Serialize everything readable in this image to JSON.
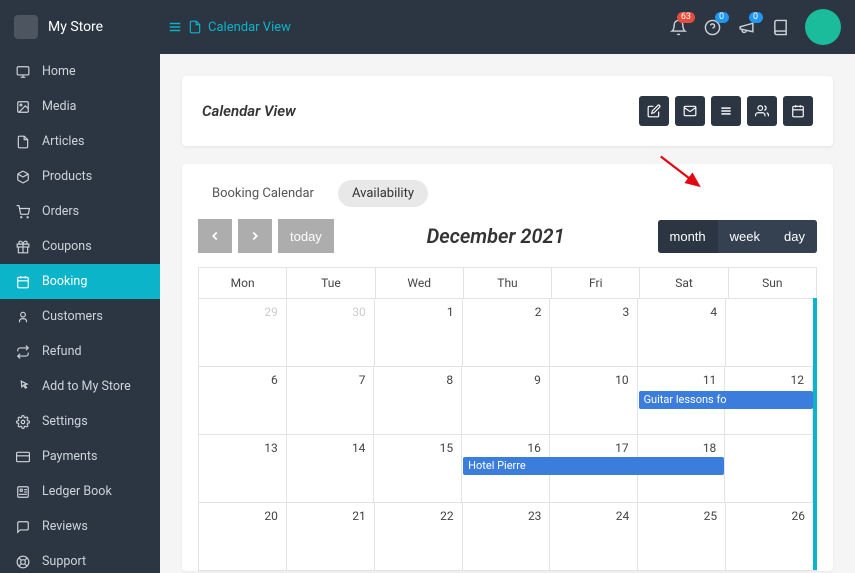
{
  "header": {
    "brand": "My Store",
    "breadcrumb": "Calendar View"
  },
  "top_badges": {
    "notifications": "63",
    "help": "0",
    "announce": "0"
  },
  "sidebar": {
    "items": [
      {
        "label": "Home",
        "icon": "monitor"
      },
      {
        "label": "Media",
        "icon": "image"
      },
      {
        "label": "Articles",
        "icon": "file"
      },
      {
        "label": "Products",
        "icon": "box"
      },
      {
        "label": "Orders",
        "icon": "cart"
      },
      {
        "label": "Coupons",
        "icon": "gift"
      },
      {
        "label": "Booking",
        "icon": "calendar",
        "active": true
      },
      {
        "label": "Customers",
        "icon": "user"
      },
      {
        "label": "Refund",
        "icon": "exchange"
      },
      {
        "label": "Add to My Store",
        "icon": "pointer"
      },
      {
        "label": "Settings",
        "icon": "gear"
      },
      {
        "label": "Payments",
        "icon": "card"
      },
      {
        "label": "Ledger Book",
        "icon": "ledger"
      },
      {
        "label": "Reviews",
        "icon": "chat"
      },
      {
        "label": "Support",
        "icon": "life"
      }
    ]
  },
  "page": {
    "title": "Calendar View"
  },
  "calendar": {
    "tabs": [
      "Booking Calendar",
      "Availability"
    ],
    "today": "today",
    "title": "December 2021",
    "views": {
      "month": "month",
      "week": "week",
      "day": "day"
    },
    "day_names": [
      "Mon",
      "Tue",
      "Wed",
      "Thu",
      "Fri",
      "Sat",
      "Sun"
    ],
    "weeks": [
      [
        {
          "d": "29",
          "f": true
        },
        {
          "d": "30",
          "f": true
        },
        {
          "d": "1"
        },
        {
          "d": "2"
        },
        {
          "d": "3"
        },
        {
          "d": "4"
        },
        {
          "d": ""
        }
      ],
      [
        {
          "d": "6"
        },
        {
          "d": "7"
        },
        {
          "d": "8"
        },
        {
          "d": "9"
        },
        {
          "d": "10"
        },
        {
          "d": "11"
        },
        {
          "d": "12"
        }
      ],
      [
        {
          "d": "13"
        },
        {
          "d": "14"
        },
        {
          "d": "15"
        },
        {
          "d": "16"
        },
        {
          "d": "17"
        },
        {
          "d": "18"
        },
        {
          "d": ""
        }
      ],
      [
        {
          "d": "20"
        },
        {
          "d": "21"
        },
        {
          "d": "22"
        },
        {
          "d": "23"
        },
        {
          "d": "24"
        },
        {
          "d": "25"
        },
        {
          "d": "26"
        }
      ]
    ],
    "events": {
      "guitar": {
        "label": "Guitar lessons fo"
      },
      "hotel": {
        "label": "Hotel Pierre"
      }
    }
  }
}
